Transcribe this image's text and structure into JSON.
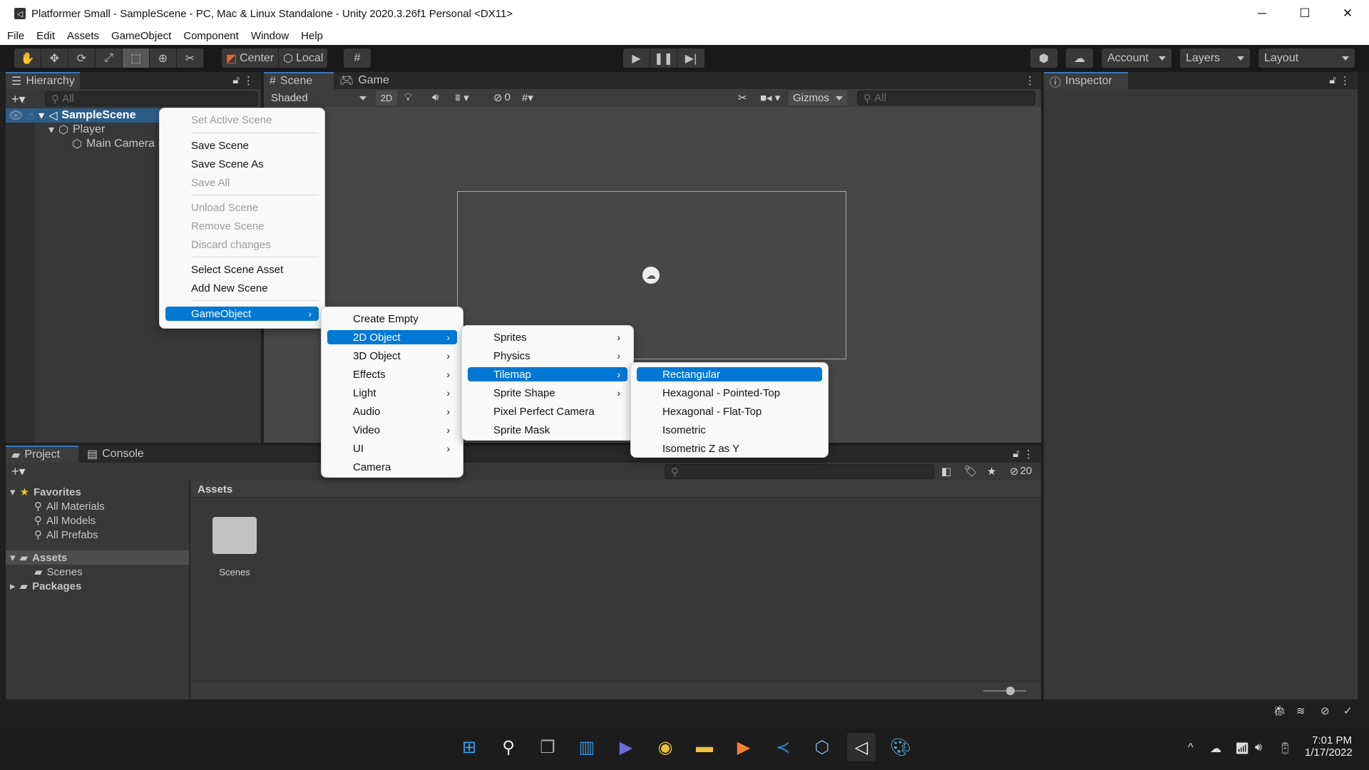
{
  "window": {
    "title": "Platformer Small - SampleScene - PC, Mac & Linux Standalone - Unity 2020.3.26f1 Personal <DX11>",
    "minimize": "─",
    "maximize": "☐",
    "close": "✕"
  },
  "menubar": [
    "File",
    "Edit",
    "Assets",
    "GameObject",
    "Component",
    "Window",
    "Help"
  ],
  "toolbar": {
    "tools": [
      "hand-tool",
      "move-tool",
      "rotate-tool",
      "scale-tool",
      "rect-tool",
      "transform-tool",
      "custom-tool"
    ],
    "active_tool": "rect-tool",
    "pivot": "Center",
    "space": "Local",
    "account": "Account",
    "layers": "Layers",
    "layout": "Layout"
  },
  "hierarchy": {
    "tab": "Hierarchy",
    "search_placeholder": "All",
    "items": [
      {
        "label": "SampleScene",
        "depth": 0,
        "selected": true
      },
      {
        "label": "Player",
        "depth": 1
      },
      {
        "label": "Main Camera",
        "depth": 2
      }
    ]
  },
  "scene": {
    "tabs": [
      "Scene",
      "Game"
    ],
    "active_tab": "Scene",
    "draw_mode": "Shaded",
    "mode_2d": "2D",
    "hidden_count": "0",
    "gizmos": "Gizmos",
    "search_placeholder": "All"
  },
  "inspector": {
    "tab": "Inspector"
  },
  "context_menu": {
    "items": [
      {
        "label": "Set Active Scene",
        "disabled": true
      },
      {
        "sep": true
      },
      {
        "label": "Save Scene"
      },
      {
        "label": "Save Scene As"
      },
      {
        "label": "Save All",
        "disabled": true
      },
      {
        "sep": true
      },
      {
        "label": "Unload Scene",
        "disabled": true
      },
      {
        "label": "Remove Scene",
        "disabled": true
      },
      {
        "label": "Discard changes",
        "disabled": true
      },
      {
        "sep": true
      },
      {
        "label": "Select Scene Asset"
      },
      {
        "label": "Add New Scene"
      },
      {
        "sep": true
      },
      {
        "label": "GameObject",
        "submenu": true,
        "selected": true
      }
    ]
  },
  "gameobject_menu": {
    "items": [
      {
        "label": "Create Empty"
      },
      {
        "label": "2D Object",
        "submenu": true,
        "selected": true
      },
      {
        "label": "3D Object",
        "submenu": true
      },
      {
        "label": "Effects",
        "submenu": true
      },
      {
        "label": "Light",
        "submenu": true
      },
      {
        "label": "Audio",
        "submenu": true
      },
      {
        "label": "Video",
        "submenu": true
      },
      {
        "label": "UI",
        "submenu": true
      },
      {
        "label": "Camera"
      }
    ]
  },
  "object2d_menu": {
    "items": [
      {
        "label": "Sprites",
        "submenu": true
      },
      {
        "label": "Physics",
        "submenu": true
      },
      {
        "label": "Tilemap",
        "submenu": true,
        "selected": true
      },
      {
        "label": "Sprite Shape",
        "submenu": true
      },
      {
        "label": "Pixel Perfect Camera"
      },
      {
        "label": "Sprite Mask"
      }
    ]
  },
  "tilemap_menu": {
    "items": [
      {
        "label": "Rectangular",
        "selected": true
      },
      {
        "label": "Hexagonal - Pointed-Top"
      },
      {
        "label": "Hexagonal - Flat-Top"
      },
      {
        "label": "Isometric"
      },
      {
        "label": "Isometric Z as Y"
      }
    ]
  },
  "project": {
    "tabs": [
      "Project",
      "Console"
    ],
    "favorites_label": "Favorites",
    "favorites": [
      "All Materials",
      "All Models",
      "All Prefabs"
    ],
    "assets_label": "Assets",
    "asset_children": [
      "Scenes"
    ],
    "packages_label": "Packages",
    "breadcrumb": "Assets",
    "hidden_count": "20",
    "grid_items": [
      {
        "label": "Scenes",
        "type": "folder"
      }
    ]
  },
  "taskbar": {
    "time": "7:01 PM",
    "date": "1/17/2022"
  },
  "colors": {
    "selection": "#2c5d87",
    "menu_highlight": "#0078d4",
    "panel": "#383838",
    "toolbar": "#191919"
  }
}
